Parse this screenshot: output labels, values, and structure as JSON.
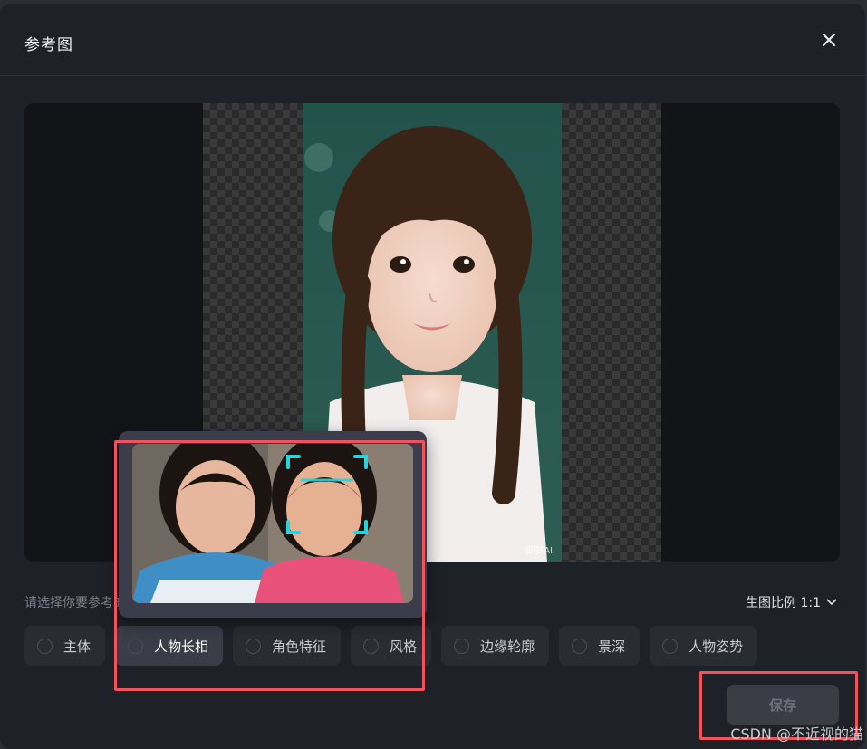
{
  "dialog": {
    "title": "参考图",
    "close_icon": "close-icon"
  },
  "preview": {
    "watermark": "即梦AI"
  },
  "prompt": "请选择你要参考的内容",
  "ratio": {
    "label": "生图比例 1:1",
    "icon": "chevron-down-icon"
  },
  "options": [
    {
      "label": "主体",
      "selected": false
    },
    {
      "label": "人物长相",
      "selected": true
    },
    {
      "label": "角色特征",
      "selected": false
    },
    {
      "label": "风格",
      "selected": false
    },
    {
      "label": "边缘轮廓",
      "selected": false
    },
    {
      "label": "景深",
      "selected": false
    },
    {
      "label": "人物姿势",
      "selected": false
    }
  ],
  "save_label": "保存",
  "overlay_watermark": "CSDN @不近视的猫",
  "colors": {
    "annotation": "#f0525e",
    "face_frame": "#27d3dc",
    "background": "#1f2128"
  }
}
